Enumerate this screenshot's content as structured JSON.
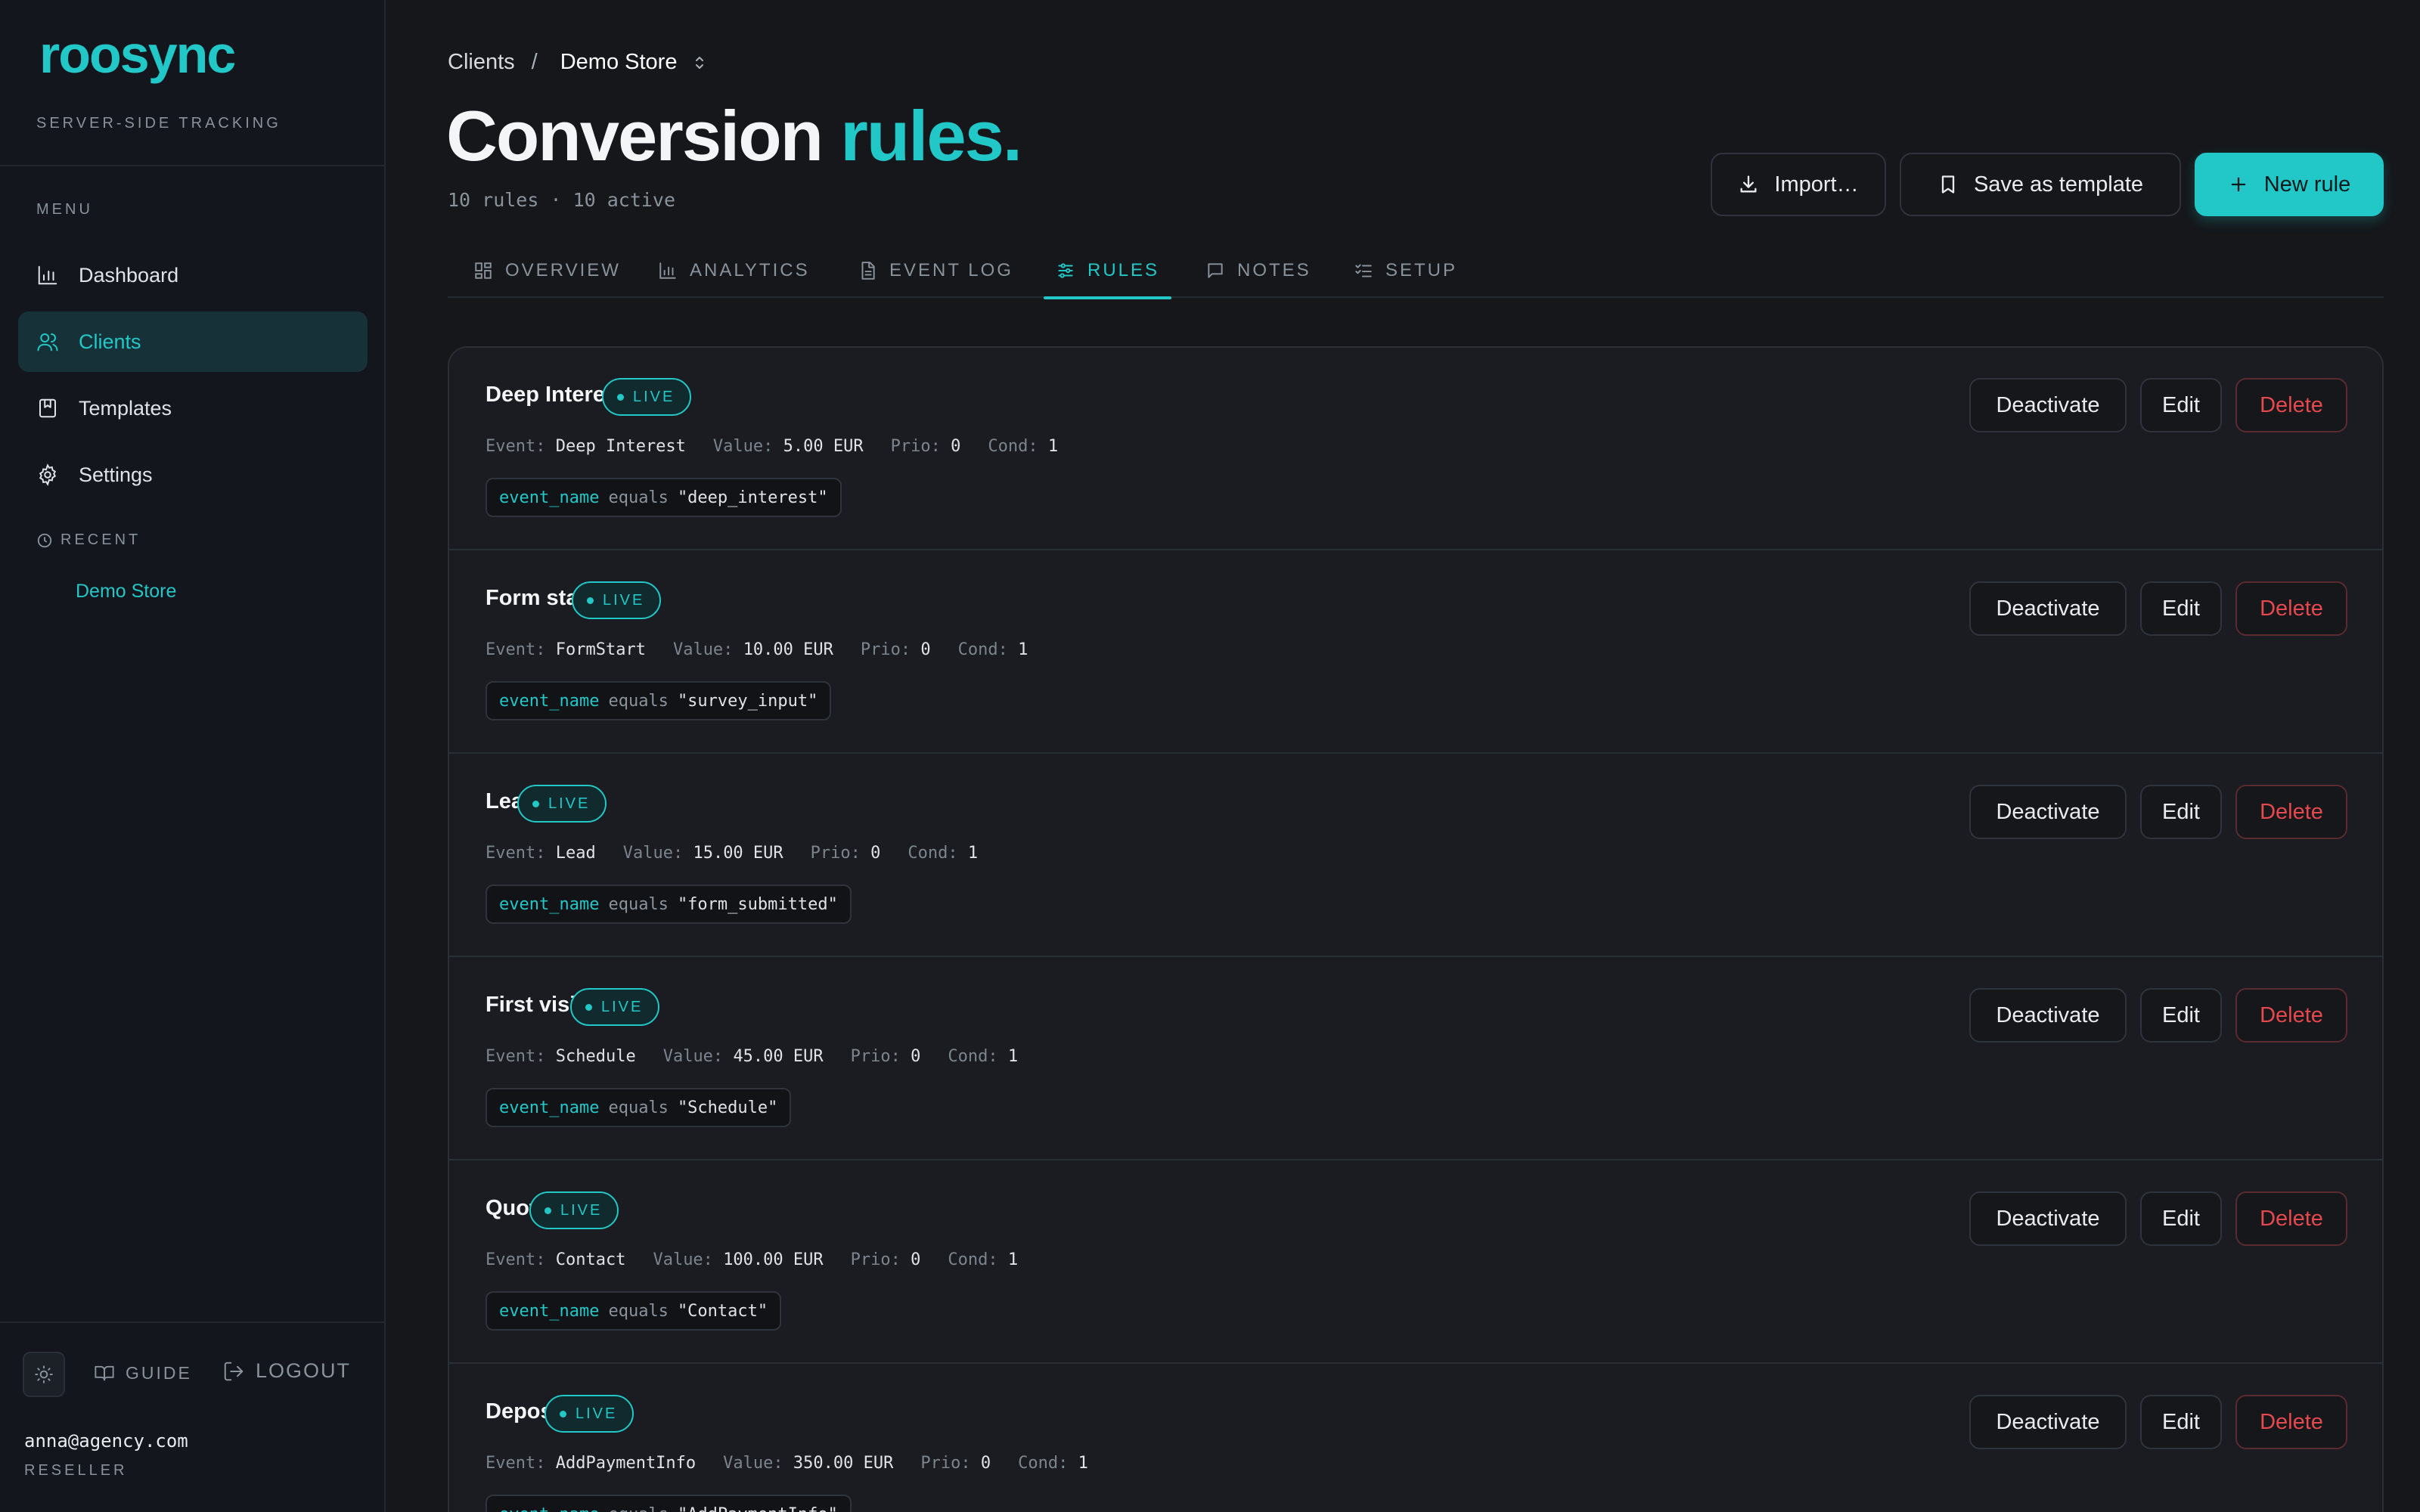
{
  "brand": {
    "logo_text": "roosync",
    "tagline": "SERVER-SIDE TRACKING",
    "accent_color": "#22c7c7"
  },
  "sidebar": {
    "menu_label": "MENU",
    "items": [
      {
        "label": "Dashboard",
        "icon": "bar-chart-icon",
        "active": false
      },
      {
        "label": "Clients",
        "icon": "users-icon",
        "active": true
      },
      {
        "label": "Templates",
        "icon": "bookmark-book-icon",
        "active": false
      },
      {
        "label": "Settings",
        "icon": "gear-icon",
        "active": false
      }
    ],
    "recent_label": "RECENT",
    "recent_items": [
      "Demo Store"
    ],
    "guide_label": "GUIDE",
    "logout_label": "LOGOUT",
    "user_email": "anna@agency.com",
    "user_role": "RESELLER"
  },
  "breadcrumb": {
    "parent": "Clients",
    "separator": "/",
    "current": "Demo Store"
  },
  "header": {
    "title_main": "Conversion",
    "title_accent": "rules.",
    "subtitle": "10 rules · 10 active",
    "import_label": "Import…",
    "save_template_label": "Save as template",
    "new_rule_label": "New rule"
  },
  "tabs": [
    {
      "label": "OVERVIEW",
      "icon": "grid-icon",
      "active": false
    },
    {
      "label": "ANALYTICS",
      "icon": "bar-chart-icon",
      "active": false
    },
    {
      "label": "EVENT LOG",
      "icon": "document-icon",
      "active": false
    },
    {
      "label": "RULES",
      "icon": "sliders-icon",
      "active": true
    },
    {
      "label": "NOTES",
      "icon": "message-icon",
      "active": false
    },
    {
      "label": "SETUP",
      "icon": "checklist-icon",
      "active": false
    }
  ],
  "rule_labels": {
    "live": "LIVE",
    "event": "Event:",
    "value": "Value:",
    "prio": "Prio:",
    "cond": "Cond:",
    "deactivate": "Deactivate",
    "edit": "Edit",
    "delete": "Delete"
  },
  "rules": [
    {
      "name": "Deep Interest",
      "event": "Deep Interest",
      "value": "5.00 EUR",
      "prio": "0",
      "cond": "1",
      "field": "event_name",
      "operator": "equals",
      "match": "\"deep_interest\""
    },
    {
      "name": "Form start",
      "event": "FormStart",
      "value": "10.00 EUR",
      "prio": "0",
      "cond": "1",
      "field": "event_name",
      "operator": "equals",
      "match": "\"survey_input\""
    },
    {
      "name": "Lead",
      "event": "Lead",
      "value": "15.00 EUR",
      "prio": "0",
      "cond": "1",
      "field": "event_name",
      "operator": "equals",
      "match": "\"form_submitted\""
    },
    {
      "name": "First visit",
      "event": "Schedule",
      "value": "45.00 EUR",
      "prio": "0",
      "cond": "1",
      "field": "event_name",
      "operator": "equals",
      "match": "\"Schedule\""
    },
    {
      "name": "Quote",
      "event": "Contact",
      "value": "100.00 EUR",
      "prio": "0",
      "cond": "1",
      "field": "event_name",
      "operator": "equals",
      "match": "\"Contact\""
    },
    {
      "name": "Deposit",
      "event": "AddPaymentInfo",
      "value": "350.00 EUR",
      "prio": "0",
      "cond": "1",
      "field": "event_name",
      "operator": "equals",
      "match": "\"AddPaymentInfo\""
    }
  ]
}
